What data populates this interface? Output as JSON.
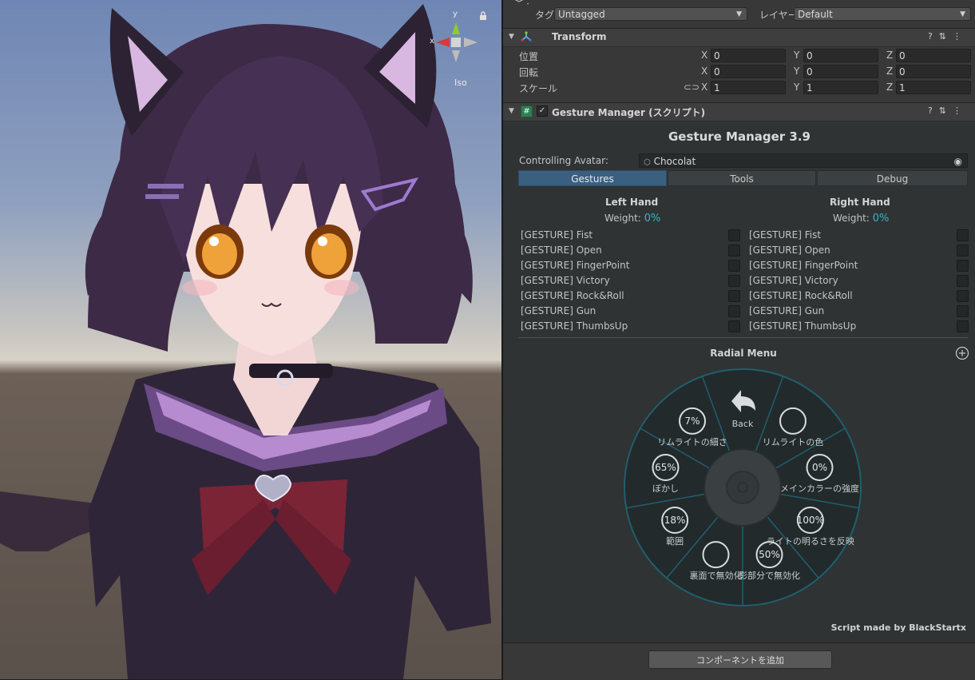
{
  "scene": {
    "gizmo": {
      "y_label": "y",
      "x_label": "x",
      "projection": "Iso",
      "lock_icon": "lock-icon"
    }
  },
  "inspector": {
    "tag_label": "タグ",
    "tag_value": "Untagged",
    "layer_label": "レイヤー",
    "layer_value": "Default",
    "transform": {
      "title": "Transform",
      "position_label": "位置",
      "rotation_label": "回転",
      "scale_label": "スケール",
      "axes": [
        "X",
        "Y",
        "Z"
      ],
      "position": [
        "0",
        "0",
        "0"
      ],
      "rotation": [
        "0",
        "0",
        "0"
      ],
      "scale": [
        "1",
        "1",
        "1"
      ]
    },
    "gesture_component": {
      "title": "Gesture Manager (スクリプト)",
      "heading": "Gesture Manager 3.9",
      "controlling_label": "Controlling Avatar:",
      "controlling_value": "Chocolat",
      "tabs": [
        "Gestures",
        "Tools",
        "Debug"
      ],
      "active_tab": "Gestures",
      "left_hand": {
        "title": "Left Hand",
        "weight_label": "Weight:",
        "weight_value": "0%"
      },
      "right_hand": {
        "title": "Right Hand",
        "weight_label": "Weight:",
        "weight_value": "0%"
      },
      "gestures": [
        "[GESTURE] Fist",
        "[GESTURE] Open",
        "[GESTURE] FingerPoint",
        "[GESTURE] Victory",
        "[GESTURE] Rock&Roll",
        "[GESTURE] Gun",
        "[GESTURE] ThumbsUp"
      ],
      "radial_title": "Radial Menu",
      "radial_items": [
        {
          "label": "Back",
          "value": ""
        },
        {
          "label": "リムライトの色",
          "value": ""
        },
        {
          "label": "メインカラーの強度",
          "value": "0%"
        },
        {
          "label": "ライトの明るさを反映",
          "value": "100%"
        },
        {
          "label": "影部分で無効化",
          "value": "50%"
        },
        {
          "label": "裏面で無効化",
          "value": ""
        },
        {
          "label": "範囲",
          "value": "18%"
        },
        {
          "label": "ぼかし",
          "value": "65%"
        },
        {
          "label": "リムライトの細さ",
          "value": "7%"
        }
      ],
      "credit": "Script made by BlackStartx"
    },
    "add_component_label": "コンポーネントを追加"
  },
  "colors": {
    "accent": "#3fb3c4",
    "tab_active": "#3b607f",
    "radial_bg": "#232a2c",
    "radial_ring": "#1f5f6e"
  }
}
